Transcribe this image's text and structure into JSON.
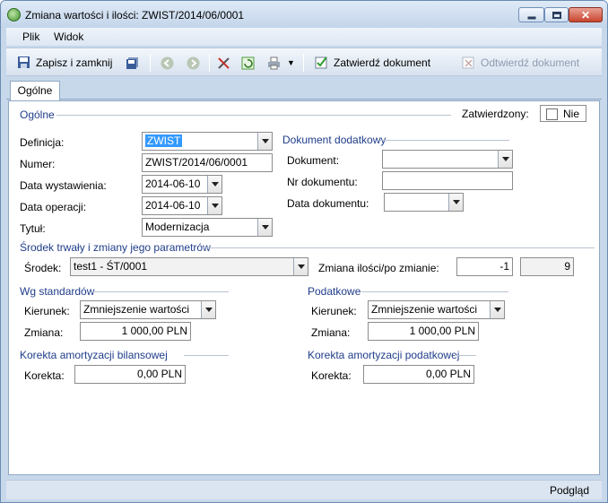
{
  "window": {
    "title": "Zmiana wartości i ilości: ZWIST/2014/06/0001"
  },
  "menu": {
    "plik": "Plik",
    "widok": "Widok"
  },
  "toolbar": {
    "save_close": "Zapisz i zamknij",
    "approve": "Zatwierdź dokument",
    "unapprove": "Odtwierdź dokument"
  },
  "tabs": {
    "general": "Ogólne"
  },
  "general": {
    "section": "Ogólne",
    "approved_label": "Zatwierdzony:",
    "approved_value": "Nie",
    "definition_label": "Definicja:",
    "definition_value": "ZWIST",
    "number_label": "Numer:",
    "number_value": "ZWIST/2014/06/0001",
    "issue_date_label": "Data wystawienia:",
    "issue_date_value": "2014-06-10",
    "op_date_label": "Data operacji:",
    "op_date_value": "2014-06-10",
    "title_label": "Tytuł:",
    "title_value": "Modernizacja"
  },
  "extra_doc": {
    "section": "Dokument dodatkowy",
    "doc_label": "Dokument:",
    "doc_value": "",
    "nr_label": "Nr dokumentu:",
    "nr_value": "",
    "date_label": "Data dokumentu:",
    "date_value": ""
  },
  "asset": {
    "section": "Środek trwały i zmiany jego parametrów",
    "asset_label": "Środek:",
    "asset_value": "test1 - ŚT/0001",
    "qty_label": "Zmiana ilości/po zmianie:",
    "qty_change": "-1",
    "qty_after": "9"
  },
  "standards": {
    "section": "Wg standardów",
    "direction_label": "Kierunek:",
    "direction_value": "Zmniejszenie wartości",
    "change_label": "Zmiana:",
    "change_value": "1 000,00 PLN"
  },
  "tax": {
    "section": "Podatkowe",
    "direction_label": "Kierunek:",
    "direction_value": "Zmniejszenie wartości",
    "change_label": "Zmiana:",
    "change_value": "1 000,00 PLN"
  },
  "corr_balance": {
    "section": "Korekta amortyzacji bilansowej",
    "label": "Korekta:",
    "value": "0,00 PLN"
  },
  "corr_tax": {
    "section": "Korekta amortyzacji podatkowej",
    "label": "Korekta:",
    "value": "0,00 PLN"
  },
  "status": {
    "preview": "Podgląd"
  }
}
